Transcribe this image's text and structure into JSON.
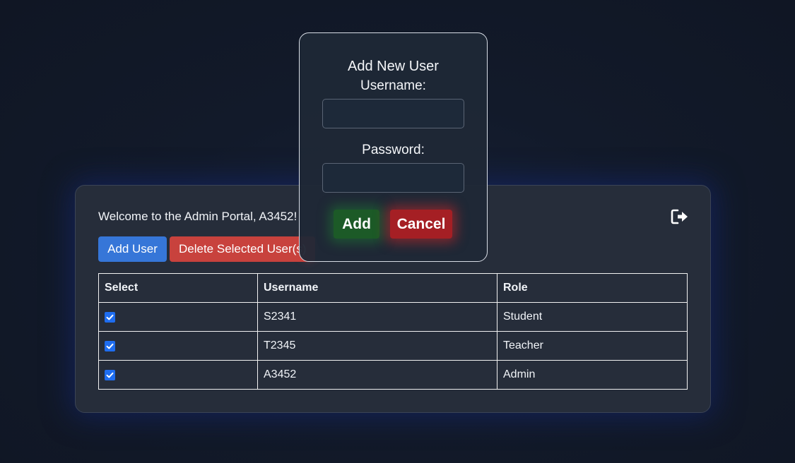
{
  "colors": {
    "background": "#111827",
    "panel": "#262d3a",
    "add_user_button": "#3676d8",
    "delete_button": "#c8423d",
    "checkbox": "#1e6df0",
    "modal_add": "#1c5a27",
    "modal_cancel": "#a51f24"
  },
  "header": {
    "welcome_text": "Welcome to the Admin Portal, A3452!",
    "logout_icon": "logout-icon"
  },
  "toolbar": {
    "add_user_label": "Add User",
    "delete_label": "Delete Selected User(s)"
  },
  "table": {
    "columns": [
      "Select",
      "Username",
      "Role"
    ],
    "rows": [
      {
        "checked": true,
        "username": "S2341",
        "role": "Student"
      },
      {
        "checked": true,
        "username": "T2345",
        "role": "Teacher"
      },
      {
        "checked": true,
        "username": "A3452",
        "role": "Admin"
      }
    ]
  },
  "modal": {
    "title": "Add New User",
    "username_label": "Username:",
    "username_value": "",
    "password_label": "Password:",
    "password_value": "",
    "add_label": "Add",
    "cancel_label": "Cancel"
  }
}
